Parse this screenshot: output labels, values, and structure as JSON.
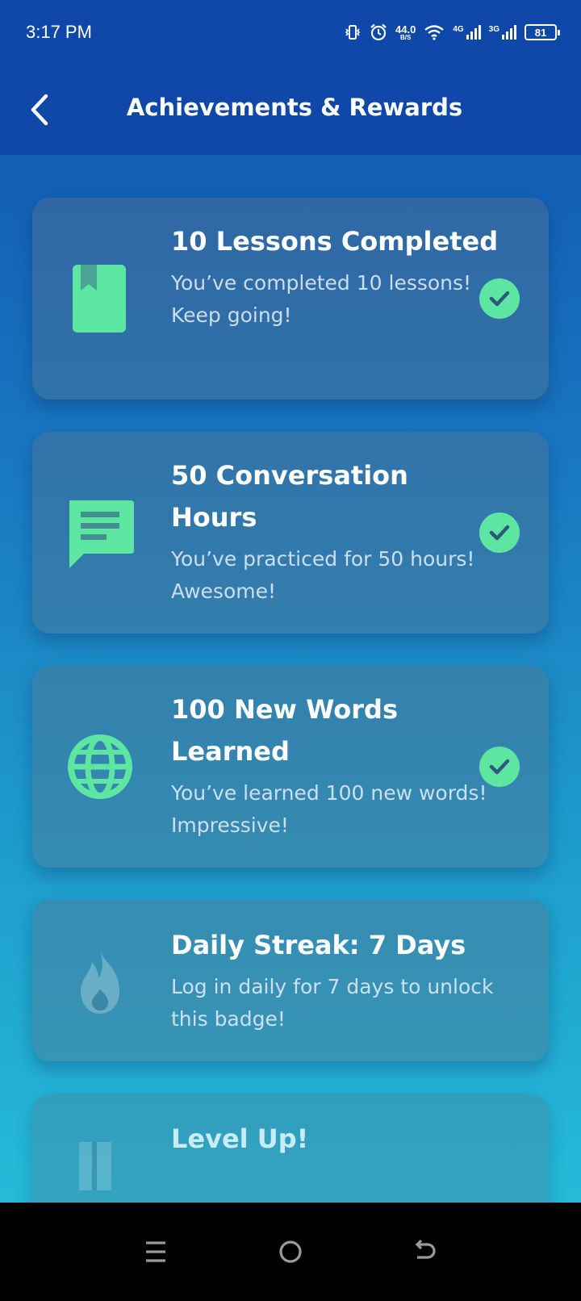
{
  "status_bar": {
    "time": "3:17 PM",
    "net_speed_value": "44.0",
    "net_speed_unit": "B/S",
    "signal_1_label": "4G",
    "signal_2_label": "3G",
    "battery_level": "81"
  },
  "header": {
    "title": "Achievements & Rewards",
    "back_icon": "chevron-left-icon"
  },
  "achievements": [
    {
      "title": "10 Lessons Completed",
      "description": "You’ve completed 10 lessons! Keep going!",
      "icon": "book-icon",
      "status": "unlocked"
    },
    {
      "title": "50 Conversation Hours",
      "description": "You’ve practiced for 50 hours! Awesome!",
      "icon": "chat-icon",
      "status": "unlocked"
    },
    {
      "title": "100 New Words Learned",
      "description": "You’ve learned 100 new words! Impressive!",
      "icon": "globe-icon",
      "status": "unlocked"
    },
    {
      "title": "Daily Streak: 7 Days",
      "description": "Log in daily for 7 days to unlock this badge!",
      "icon": "flame-icon",
      "status": "locked"
    },
    {
      "title": "Level Up!",
      "description": "",
      "icon": "level-icon",
      "status": "locked"
    }
  ],
  "colors": {
    "accent": "#5de6a2",
    "header_bg": "#0f48a8",
    "gradient_top": "#1150b0",
    "gradient_bottom": "#26c3dc"
  },
  "nav_bar": {
    "menu_icon": "menu-icon",
    "home_icon": "home-circle-icon",
    "back_icon": "back-arrow-icon"
  }
}
